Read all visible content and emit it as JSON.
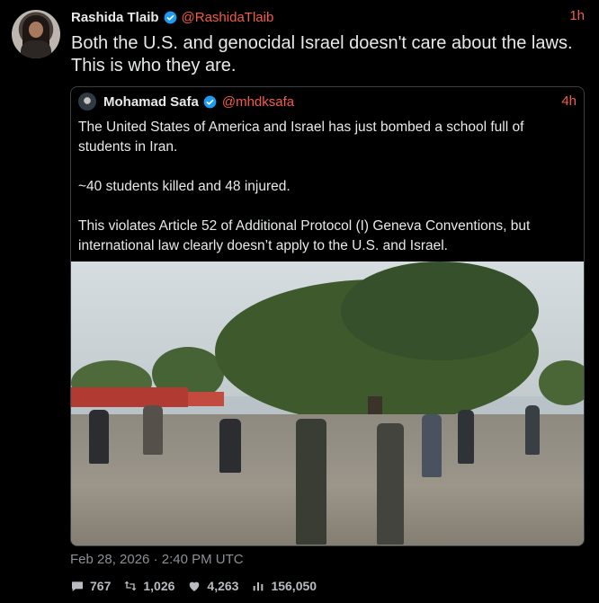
{
  "tweet": {
    "author_name": "Rashida Tlaib",
    "handle": "@RashidaTlaib",
    "time": "1h",
    "text": "Both the U.S. and genocidal Israel doesn't care about the laws. This is who they are."
  },
  "quoted_tweet": {
    "author_name": "Mohamad Safa",
    "handle": "@mhdksafa",
    "time": "4h",
    "paragraphs": [
      "The United States of America and Israel has just bombed a school full of students in Iran.",
      "~40 students killed and 48 injured.",
      "This violates Article 52 of Additional Protocol (I) Geneva Conventions, but international law clearly doesn’t apply to the U.S. and Israel."
    ]
  },
  "footer": {
    "timestamp": "Feb 28, 2026 · 2:40 PM UTC",
    "replies": "767",
    "retweets": "1,026",
    "likes": "4,263",
    "views": "156,050"
  },
  "icons": {
    "verified": "verified-badge-icon",
    "reply": "comment-icon",
    "retweet": "retweet-icon",
    "like": "heart-icon",
    "views": "bar-chart-icon"
  },
  "colors": {
    "background": "#000000",
    "accent": "#f25c4a",
    "verified": "#1d9bf0",
    "muted": "#8b9096"
  }
}
